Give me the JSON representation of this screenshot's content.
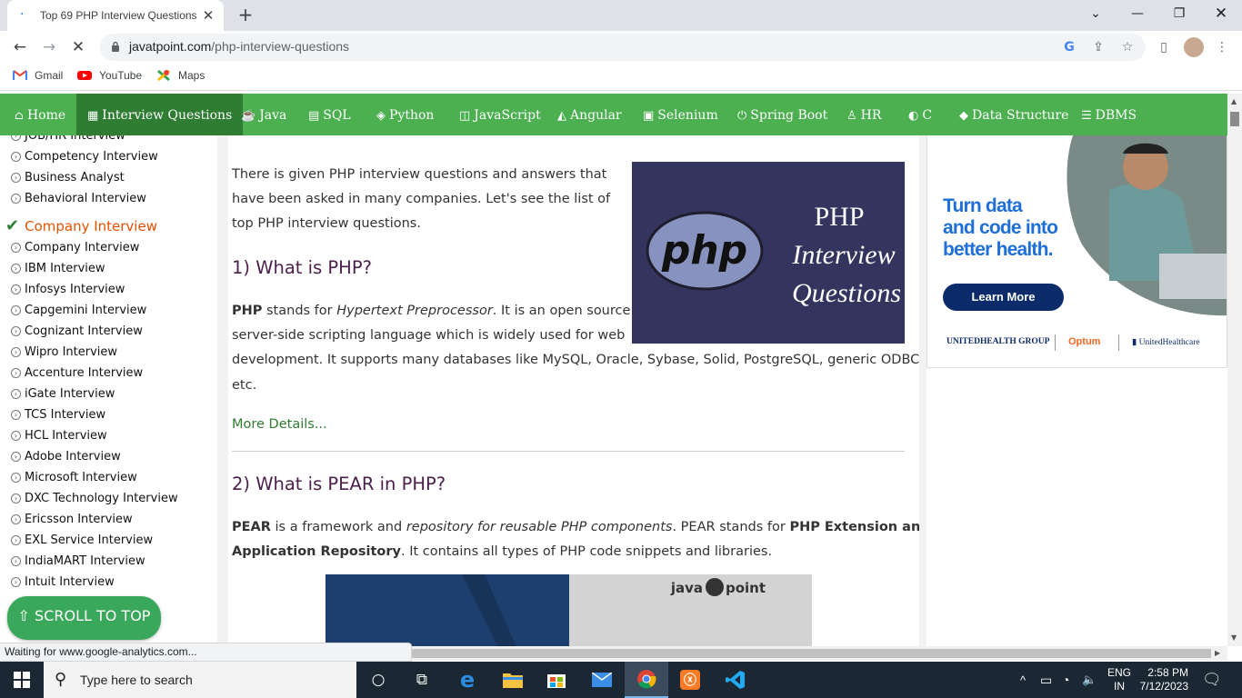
{
  "browser": {
    "tab_title": "Top 69 PHP Interview Questions",
    "url_host": "javatpoint.com",
    "url_path": "/php-interview-questions",
    "bookmarks": [
      "Gmail",
      "YouTube",
      "Maps"
    ],
    "status_text": "Waiting for www.google-analytics.com..."
  },
  "nav": {
    "items": [
      "Home",
      "Interview Questions",
      "Java",
      "SQL",
      "Python",
      "JavaScript",
      "Angular",
      "Selenium",
      "Spring Boot",
      "HR",
      "C",
      "Data Structure",
      "DBMS"
    ],
    "active": "Interview Questions"
  },
  "sidebar": {
    "top_items": [
      "JOB/HR Interview",
      "Competency Interview",
      "Business Analyst",
      "Behavioral Interview"
    ],
    "heading": "Company Interview",
    "items": [
      "Company Interview",
      "IBM Interview",
      "Infosys Interview",
      "Capgemini Interview",
      "Cognizant Interview",
      "Wipro Interview",
      "Accenture Interview",
      "iGate Interview",
      "TCS Interview",
      "HCL Interview",
      "Adobe Interview",
      "Microsoft Interview",
      "DXC Technology Interview",
      "Ericsson Interview",
      "EXL Service Interview",
      "IndiaMART Interview",
      "Intuit Interview"
    ],
    "scroll_to_top": "⇧ SCROLL TO TOP"
  },
  "main": {
    "intro_lines": [
      "There is given PHP interview questions and answers that",
      "have been asked in many companies. Let's see the list of",
      "top PHP interview questions."
    ],
    "q1_title": "1) What is PHP?",
    "q1_bold": "PHP",
    "q1_text1": " stands for ",
    "q1_italic": "Hypertext Preprocessor",
    "q1_text2": ". It is an open source",
    "q1_line2": "server-side scripting language which is widely used for web",
    "q1_line3": "development. It supports many databases like MySQL, Oracle, Sybase, Solid, PostgreSQL, generic ODBC",
    "q1_line4": "etc.",
    "more_details": "More Details...",
    "q2_title": "2) What is PEAR in PHP?",
    "q2_bold": "PEAR",
    "q2_text1": " is a framework and ",
    "q2_italic": "repository for reusable PHP components",
    "q2_text2": ". PEAR stands for ",
    "q2_bold2": "PHP Extension and",
    "q2_bold3": "Application Repository",
    "q2_text3": ". It contains all types of PHP code snippets and libraries.",
    "php_image": {
      "logo": "php",
      "line1": "PHP",
      "line2": "Interview",
      "line3": "Questions"
    },
    "bottom_image_logo": "java",
    "bottom_image_logo2": "point"
  },
  "ad": {
    "headline": [
      "Turn data",
      "and code into",
      "better health."
    ],
    "button": "Learn More",
    "brands": [
      "UNITEDHEALTH GROUP",
      "Optum",
      "UnitedHealthcare"
    ]
  },
  "taskbar": {
    "search_placeholder": "Type here to search",
    "lang1": "ENG",
    "lang2": "IN",
    "time": "2:58 PM",
    "date": "7/12/2023"
  },
  "colors": {
    "site_green": "#4caf50",
    "active_nav": "#2e7d32",
    "heading_purple": "#4a1f4a",
    "ad_blue": "#1e6fd9"
  }
}
